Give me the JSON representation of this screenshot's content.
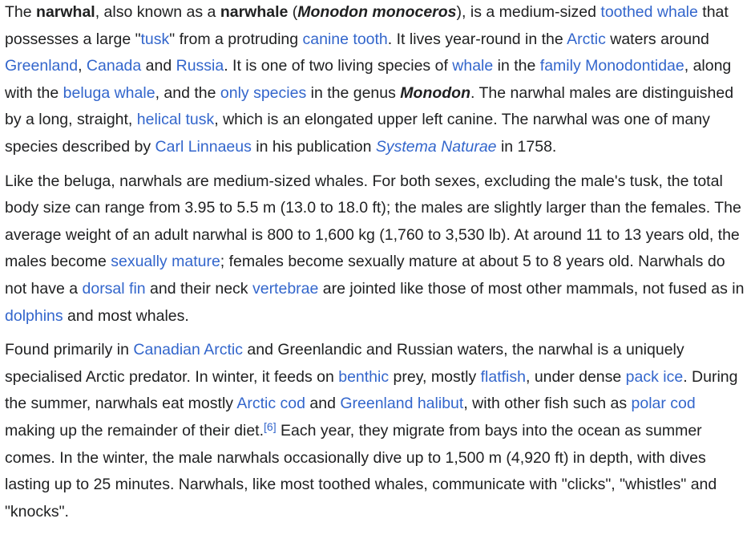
{
  "paragraphs": [
    {
      "runs": [
        {
          "text": "The "
        },
        {
          "text": "narwhal",
          "bold": true
        },
        {
          "text": ", also known as a "
        },
        {
          "text": "narwhale",
          "bold": true
        },
        {
          "text": " ("
        },
        {
          "text": "Monodon monoceros",
          "bold": true,
          "italic": true
        },
        {
          "text": "), is a medium-sized "
        },
        {
          "text": "toothed whale",
          "link": true
        },
        {
          "text": " that possesses a large \""
        },
        {
          "text": "tusk",
          "link": true
        },
        {
          "text": "\" from a protruding "
        },
        {
          "text": "canine tooth",
          "link": true
        },
        {
          "text": ". It lives year-round in the "
        },
        {
          "text": "Arctic",
          "link": true
        },
        {
          "text": " waters around "
        },
        {
          "text": "Greenland",
          "link": true
        },
        {
          "text": ", "
        },
        {
          "text": "Canada",
          "link": true
        },
        {
          "text": " and "
        },
        {
          "text": "Russia",
          "link": true
        },
        {
          "text": ". It is one of two living species of "
        },
        {
          "text": "whale",
          "link": true
        },
        {
          "text": " in the "
        },
        {
          "text": "family",
          "link": true
        },
        {
          "text": " "
        },
        {
          "text": "Monodontidae",
          "link": true
        },
        {
          "text": ", along with the "
        },
        {
          "text": "beluga whale",
          "link": true
        },
        {
          "text": ", and the "
        },
        {
          "text": "only species",
          "link": true
        },
        {
          "text": " in the genus "
        },
        {
          "text": "Monodon",
          "bold": true,
          "italic": true
        },
        {
          "text": ". The narwhal males are distinguished by a long, straight, "
        },
        {
          "text": "helical tusk",
          "link": true
        },
        {
          "text": ", which is an elongated upper left canine. The narwhal was one of many species described by "
        },
        {
          "text": "Carl Linnaeus",
          "link": true
        },
        {
          "text": " in his publication "
        },
        {
          "text": "Systema Naturae",
          "link": true,
          "italic": true
        },
        {
          "text": " in 1758."
        }
      ]
    },
    {
      "runs": [
        {
          "text": "Like the beluga, narwhals are medium-sized whales. For both sexes, excluding the male's tusk, the total body size can range from 3.95 to 5.5 m (13.0 to 18.0 ft); the males are slightly larger than the females. The average weight of an adult narwhal is 800 to 1,600 kg (1,760 to 3,530 lb). At around 11 to 13 years old, the males become "
        },
        {
          "text": "sexually mature",
          "link": true
        },
        {
          "text": "; females become sexually mature at about 5 to 8 years old. Narwhals do not have a "
        },
        {
          "text": "dorsal fin",
          "link": true
        },
        {
          "text": " and their neck "
        },
        {
          "text": "vertebrae",
          "link": true
        },
        {
          "text": " are jointed like those of most other mammals, not fused as in "
        },
        {
          "text": "dolphins",
          "link": true
        },
        {
          "text": " and most whales."
        }
      ]
    },
    {
      "runs": [
        {
          "text": "Found primarily in "
        },
        {
          "text": "Canadian Arctic",
          "link": true
        },
        {
          "text": " and Greenlandic and Russian waters, the narwhal is a uniquely specialised Arctic predator. In winter, it feeds on "
        },
        {
          "text": "benthic",
          "link": true
        },
        {
          "text": " prey, mostly "
        },
        {
          "text": "flatfish",
          "link": true
        },
        {
          "text": ", under dense "
        },
        {
          "text": "pack ice",
          "link": true
        },
        {
          "text": ". During the summer, narwhals eat mostly "
        },
        {
          "text": "Arctic cod",
          "link": true
        },
        {
          "text": " and "
        },
        {
          "text": "Greenland halibut",
          "link": true
        },
        {
          "text": ", with other fish such as "
        },
        {
          "text": "polar cod",
          "link": true
        },
        {
          "text": " making up the remainder of their diet."
        },
        {
          "text": "[6]",
          "link": true,
          "sup": true
        },
        {
          "text": " Each year, they migrate from bays into the ocean as summer comes. In the winter, the male narwhals occasionally dive up to 1,500 m (4,920 ft) in depth, with dives lasting up to 25 minutes. Narwhals, like most toothed whales, communicate with \"clicks\", \"whistles\" and \"knocks\"."
        }
      ]
    }
  ]
}
